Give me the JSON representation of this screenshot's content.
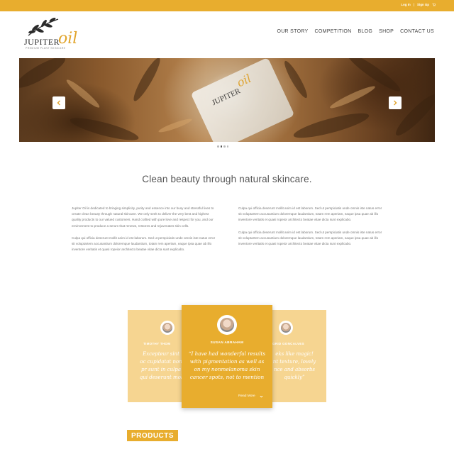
{
  "topbar": {
    "login_label": "Log In",
    "signup_label": "Sign Up",
    "cart_icon": "cart-icon"
  },
  "logo": {
    "brand_main": "JUPITER",
    "brand_script": "oil",
    "tagline": "PREMIUM PLANT SKINCARE"
  },
  "nav": {
    "items": [
      "OUR STORY",
      "COMPETITION",
      "BLOG",
      "SHOP",
      "CONTACT US"
    ]
  },
  "hero": {
    "bottle_text": "JUPITER",
    "bottle_script": "oil",
    "prev_icon": "chevron-left-icon",
    "next_icon": "chevron-right-icon",
    "active_slide": 2,
    "slide_count": 4
  },
  "headline": "Clean beauty through natural skincare.",
  "intro": {
    "col1": [
      "Jupiter Oil is dedicated to bringing simplicity, purity and essence into our busy and stressful lives to create clean beauty through natural skincare. We only seek to deliver the very best and highest quality products to our valued customers. Hand crafted with pure love and respect for you, and our environment to produce a serum that renews, restores and rejuvenates skin cells.",
      "Culpa qui officia deserunt mollit anim id est laborum. Sed ut perspiciatis unde omnis iste natus error sit voluptartem accusantium doloremque laudantium, totam rem aperiam, eaque ipsa quae ab illo inventore veritatis et quasi ropeior architecto beatae vitae dicta sunt explicabo."
    ],
    "col2": [
      "Culpa qui officia deserunt mollit anim id est laborum. Sed ut perspiciatis unde omnis iste natus error sit voluptartem accusantium doloremque laudantium, totam rem aperiam, eaque ipsa quae ab illo inventore veritatis et quasi ropeior architecto beatae vitae dicta sunt explicabo.",
      "Culpa qui officia deserunt mollit anim id est laborum. Sed ut perspiciatis unde omnis iste natus error sit voluptartem accusantium doloremque laudantium, totam rem aperiam, eaque ipsa quae ab illo inventore veritatis et quasi ropeior architecto beatae vitae dicta sunt explicabo."
    ]
  },
  "testimonials": {
    "left": {
      "name": "TIMOTHY THOM",
      "quote": "Excepteur sint oc cupidatat non pr sunt in culpa qui deserunt mol"
    },
    "main": {
      "name": "SUSAN ABRAHAM",
      "quote": "“I have had wonderful results with pigmentation as well as on my nonmelanoma skin cancer spots, not to mention",
      "readmore_label": "Read More",
      "readmore_icon": "chevron-down-icon"
    },
    "right": {
      "name": "GRID GONCALVES",
      "quote": "eks like magic! nt texture, lovely nce and absorbs quickly”"
    }
  },
  "products_heading": "PRODUCTS",
  "colors": {
    "accent": "#e8ad2e",
    "accent_light": "#f6d591",
    "text": "#555555"
  }
}
